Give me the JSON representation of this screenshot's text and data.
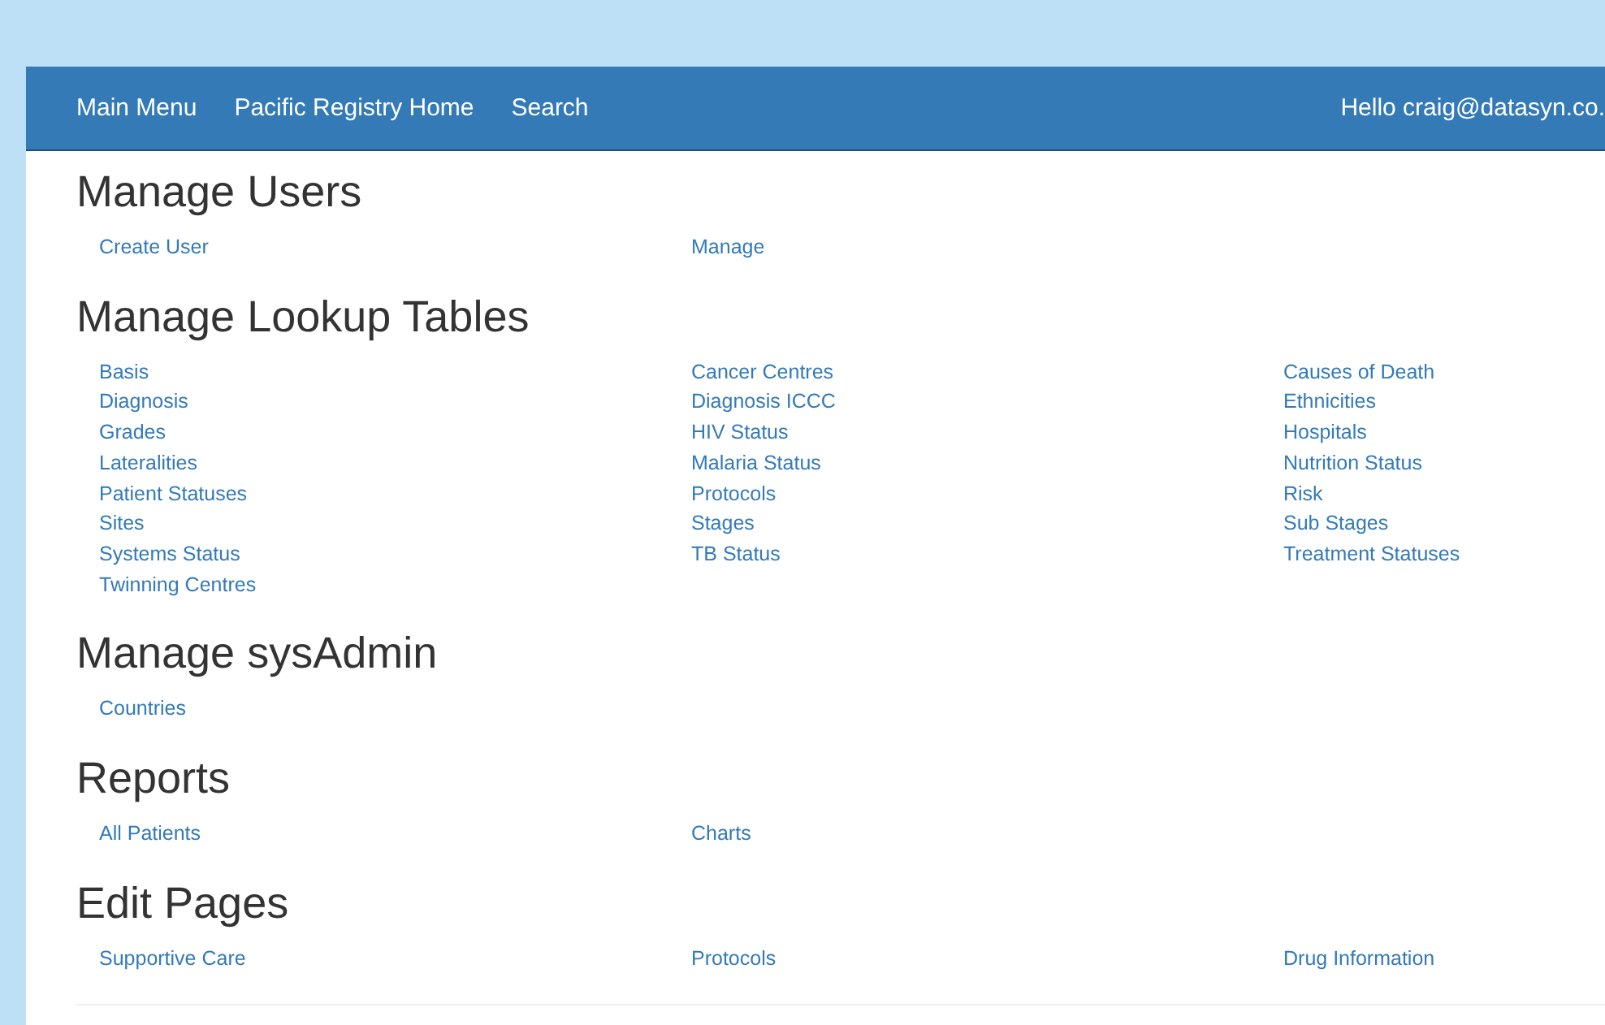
{
  "navbar": {
    "links": [
      "Main Menu",
      "Pacific Registry Home",
      "Search"
    ],
    "user": "Hello craig@datasyn.co."
  },
  "sections": [
    {
      "title": "Manage Users",
      "links": [
        "Create User",
        "Manage"
      ]
    },
    {
      "title": "Manage Lookup Tables",
      "links": [
        "Basis",
        "Cancer Centres",
        "Causes of Death",
        "Diagnosis",
        "Diagnosis ICCC",
        "Ethnicities",
        "Grades",
        "HIV Status",
        "Hospitals",
        "Lateralities",
        "Malaria Status",
        "Nutrition Status",
        "Patient Statuses",
        "Protocols",
        "Risk",
        "Sites",
        "Stages",
        "Sub Stages",
        "Systems Status",
        "TB Status",
        "Treatment Statuses",
        "Twinning Centres"
      ]
    },
    {
      "title": "Manage sysAdmin",
      "links": [
        "Countries"
      ]
    },
    {
      "title": "Reports",
      "links": [
        "All Patients",
        "Charts"
      ]
    },
    {
      "title": "Edit Pages",
      "links": [
        "Supportive Care",
        "Protocols",
        "Drug Information"
      ]
    }
  ]
}
